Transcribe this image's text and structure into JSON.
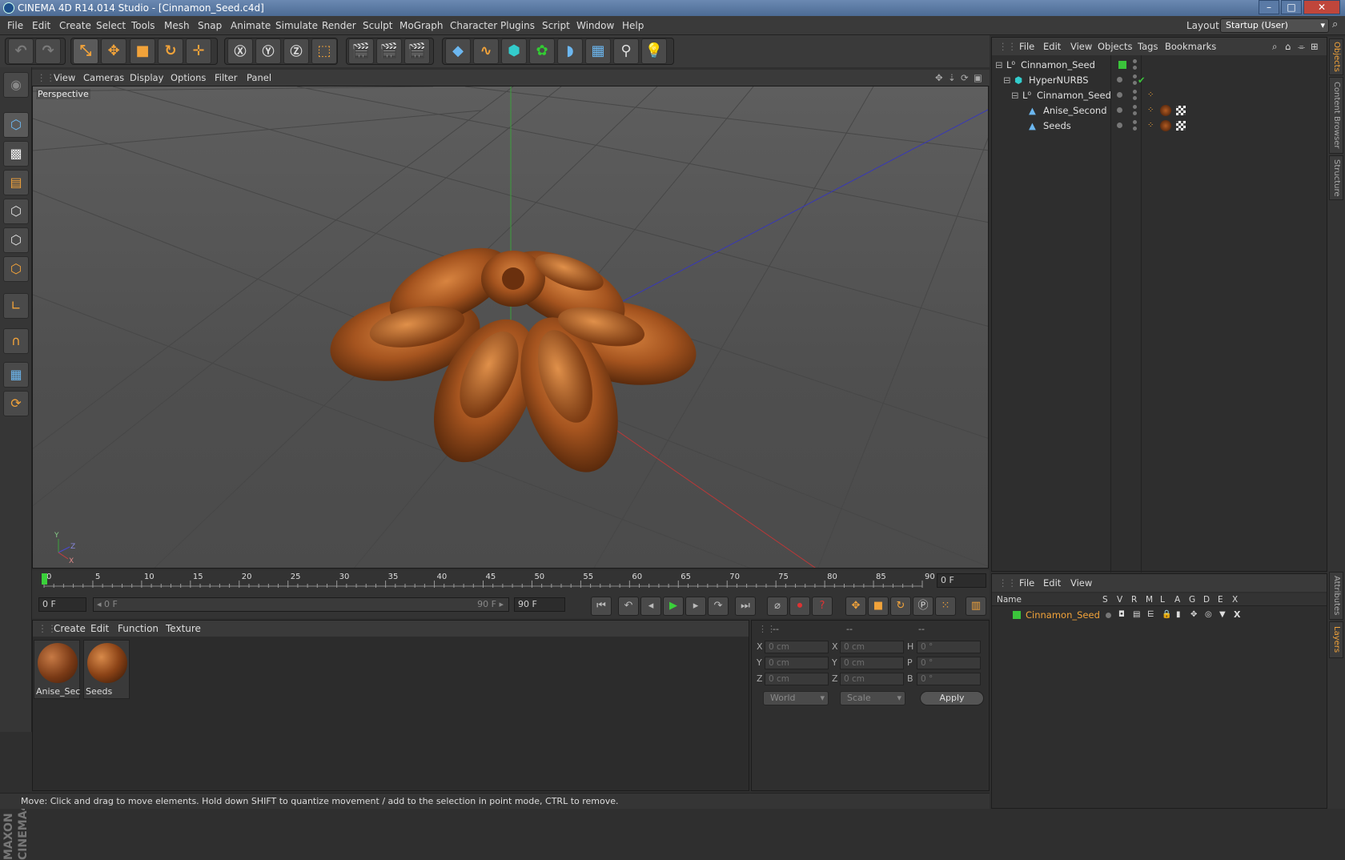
{
  "window": {
    "title": "CINEMA 4D R14.014 Studio - [Cinnamon_Seed.c4d]"
  },
  "menubar": {
    "items": [
      "File",
      "Edit",
      "Create",
      "Select",
      "Tools",
      "Mesh",
      "Snap",
      "Animate",
      "Simulate",
      "Render",
      "Sculpt",
      "MoGraph",
      "Character",
      "Plugins",
      "Script",
      "Window",
      "Help"
    ],
    "layout_label": "Layout:",
    "layout_value": "Startup (User)"
  },
  "viewport": {
    "menu": [
      "View",
      "Cameras",
      "Display",
      "Options",
      "Filter",
      "Panel"
    ],
    "label": "Perspective",
    "axis_labels": {
      "y": "Y",
      "z": "Z",
      "x": "X"
    }
  },
  "timeline": {
    "ticks": [
      "0",
      "5",
      "10",
      "15",
      "20",
      "25",
      "30",
      "35",
      "40",
      "45",
      "50",
      "55",
      "60",
      "65",
      "70",
      "75",
      "80",
      "85",
      "90"
    ],
    "current_frame": "0 F",
    "start_field": "0 F",
    "range_start": "0 F",
    "range_end": "90 F",
    "end_field": "90 F"
  },
  "materials": {
    "menu": [
      "Create",
      "Edit",
      "Function",
      "Texture"
    ],
    "items": [
      {
        "name": "Anise_Seco"
      },
      {
        "name": "Seeds"
      }
    ]
  },
  "coordinates": {
    "headers": [
      "--",
      "--",
      "--"
    ],
    "rows": [
      {
        "a": "X",
        "av": "0 cm",
        "b": "X",
        "bv": "0 cm",
        "c": "H",
        "cv": "0 °"
      },
      {
        "a": "Y",
        "av": "0 cm",
        "b": "Y",
        "bv": "0 cm",
        "c": "P",
        "cv": "0 °"
      },
      {
        "a": "Z",
        "av": "0 cm",
        "b": "Z",
        "bv": "0 cm",
        "c": "B",
        "cv": "0 °"
      }
    ],
    "mode": "World",
    "transform": "Scale",
    "apply": "Apply"
  },
  "status": {
    "text": "Move: Click and drag to move elements. Hold down SHIFT to quantize movement / add to the selection in point mode, CTRL to remove."
  },
  "objects": {
    "menu": [
      "File",
      "Edit",
      "View",
      "Objects",
      "Tags",
      "Bookmarks"
    ],
    "tree": [
      {
        "name": "Cinnamon_Seed",
        "depth": 0
      },
      {
        "name": "HyperNURBS",
        "depth": 1
      },
      {
        "name": "Cinnamon_Seed",
        "depth": 2
      },
      {
        "name": "Anise_Second",
        "depth": 3
      },
      {
        "name": "Seeds",
        "depth": 3
      }
    ]
  },
  "layers": {
    "menu": [
      "File",
      "Edit",
      "View"
    ],
    "columns": [
      "Name",
      "S",
      "V",
      "R",
      "M",
      "L",
      "A",
      "G",
      "D",
      "E",
      "X"
    ],
    "items": [
      {
        "name": "Cinnamon_Seed",
        "color": "#3bc43b"
      }
    ]
  },
  "sidetabs": [
    "Objects",
    "Content Browser",
    "Structure",
    "Attributes",
    "Layers"
  ],
  "colors": {
    "accent": "#f2a33a",
    "layer": "#3bc43b",
    "title": "#5a7aa6"
  }
}
